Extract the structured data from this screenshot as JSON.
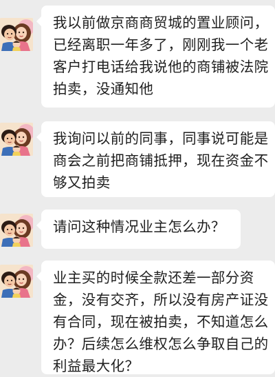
{
  "messages": [
    {
      "text": "我以前做京商商贸城的置业顾问，已经离职一年多了，刚刚我一个老客户打电话给我说他的商铺被法院拍卖，没通知他"
    },
    {
      "text": "我询问以前的同事，同事说可能是商会之前把商铺抵押，现在资金不够又拍卖"
    },
    {
      "text": "请问这种情况业主怎么办？"
    },
    {
      "text": "业主买的时候全款还差一部分资金，没有交齐，所以没有房产证没有合同，现在被拍卖，不知道怎么办？后续怎么维权怎么争取自己的利益最大化？"
    }
  ]
}
